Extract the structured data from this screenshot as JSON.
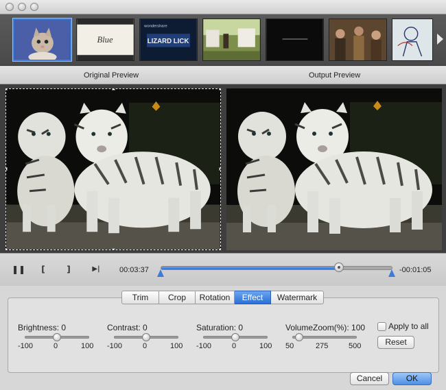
{
  "window": {
    "title_buttons": [
      "close",
      "minimize",
      "zoom"
    ],
    "accent_color": "#3d7bd8"
  },
  "filmstrip": {
    "thumbnails": [
      {
        "subject": "kitten",
        "selected": true
      },
      {
        "subject": "title card",
        "selected": false,
        "text": "Blue"
      },
      {
        "subject": "title card",
        "selected": false,
        "text": "LIZARD LICK",
        "caption": "wondershare"
      },
      {
        "subject": "outdoor scene",
        "selected": false
      },
      {
        "subject": "dark scene",
        "selected": false
      },
      {
        "subject": "crowd scene",
        "selected": false
      },
      {
        "subject": "drawing",
        "selected": false
      }
    ],
    "next_icon": "chevron-right-icon"
  },
  "preview": {
    "original_label": "Original Preview",
    "output_label": "Output Preview"
  },
  "playback": {
    "pause_glyph": "❚❚",
    "mark_in_glyph": "[",
    "mark_out_glyph": "]",
    "next_frame_glyph": "▶|",
    "current_time": "00:03:37",
    "remaining_time": "-00:01:05",
    "progress_fraction": 0.77
  },
  "tabs": [
    {
      "label": "Trim",
      "active": false
    },
    {
      "label": "Crop",
      "active": false
    },
    {
      "label": "Rotation",
      "active": false
    },
    {
      "label": "Effect",
      "active": true
    },
    {
      "label": "Watermark",
      "active": false
    }
  ],
  "effect": {
    "brightness": {
      "label": "Brightness: 0",
      "min": "-100",
      "mid": "0",
      "max": "100",
      "value": 0,
      "range": [
        -100,
        100
      ]
    },
    "contrast": {
      "label": "Contrast: 0",
      "min": "-100",
      "mid": "0",
      "max": "100",
      "value": 0,
      "range": [
        -100,
        100
      ]
    },
    "saturation": {
      "label": "Saturation: 0",
      "min": "-100",
      "mid": "0",
      "max": "100",
      "value": 0,
      "range": [
        -100,
        100
      ]
    },
    "volume": {
      "label": "VolumeZoom(%): 100",
      "min": "50",
      "mid": "275",
      "max": "500",
      "value": 100,
      "range": [
        50,
        500
      ]
    },
    "apply_all_label": "Apply to all",
    "apply_all_checked": false,
    "reset_label": "Reset"
  },
  "footer": {
    "cancel_label": "Cancel",
    "ok_label": "OK"
  }
}
